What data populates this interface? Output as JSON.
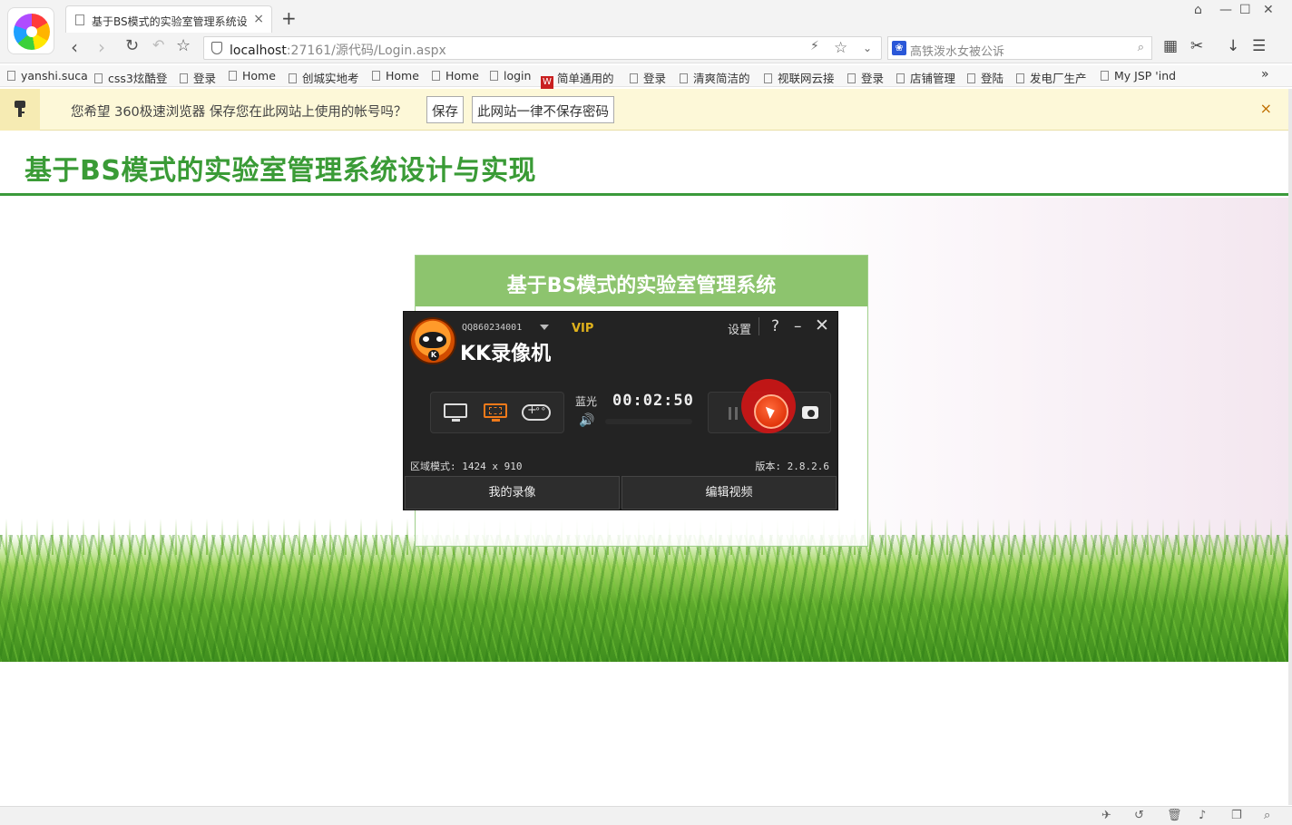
{
  "browser": {
    "tab_title": "基于BS模式的实验室管理系统设",
    "tab_close": "×",
    "new_tab": "+",
    "url_host": "localhost",
    "url_path": ":27161/源代码/Login.aspx",
    "search_placeholder": "高铁泼水女被公诉",
    "bookmarks": [
      "yanshi.suca",
      "css3炫酷登",
      "登录",
      "Home",
      "创城实地考",
      "Home",
      "Home",
      "login",
      "简单通用的",
      "登录",
      "清爽简洁的",
      "视联网云接",
      "登录",
      "店铺管理",
      "登陆",
      "发电厂生产",
      "My JSP 'ind"
    ],
    "bookmark_more": "»"
  },
  "password_bar": {
    "message": "您希望 360极速浏览器 保存您在此网站上使用的帐号吗？",
    "save_label": "保存",
    "never_label": "此网站一律不保存密码",
    "close": "×"
  },
  "page": {
    "title": "基于BS模式的实验室管理系统设计与实现",
    "login_header": "基于BS模式的实验室管理系统"
  },
  "recorder": {
    "account": "QQ860234001",
    "vip": "VIP",
    "brand": "KK录像机",
    "settings": "设置",
    "help": "?",
    "minimize": "–",
    "close": "✕",
    "quality": "蓝光",
    "timer": "00:02:50",
    "region_info": "区域模式: 1424 x 910",
    "version": "版本: 2.8.2.6",
    "my_recordings": "我的录像",
    "edit_video": "编辑视频"
  }
}
